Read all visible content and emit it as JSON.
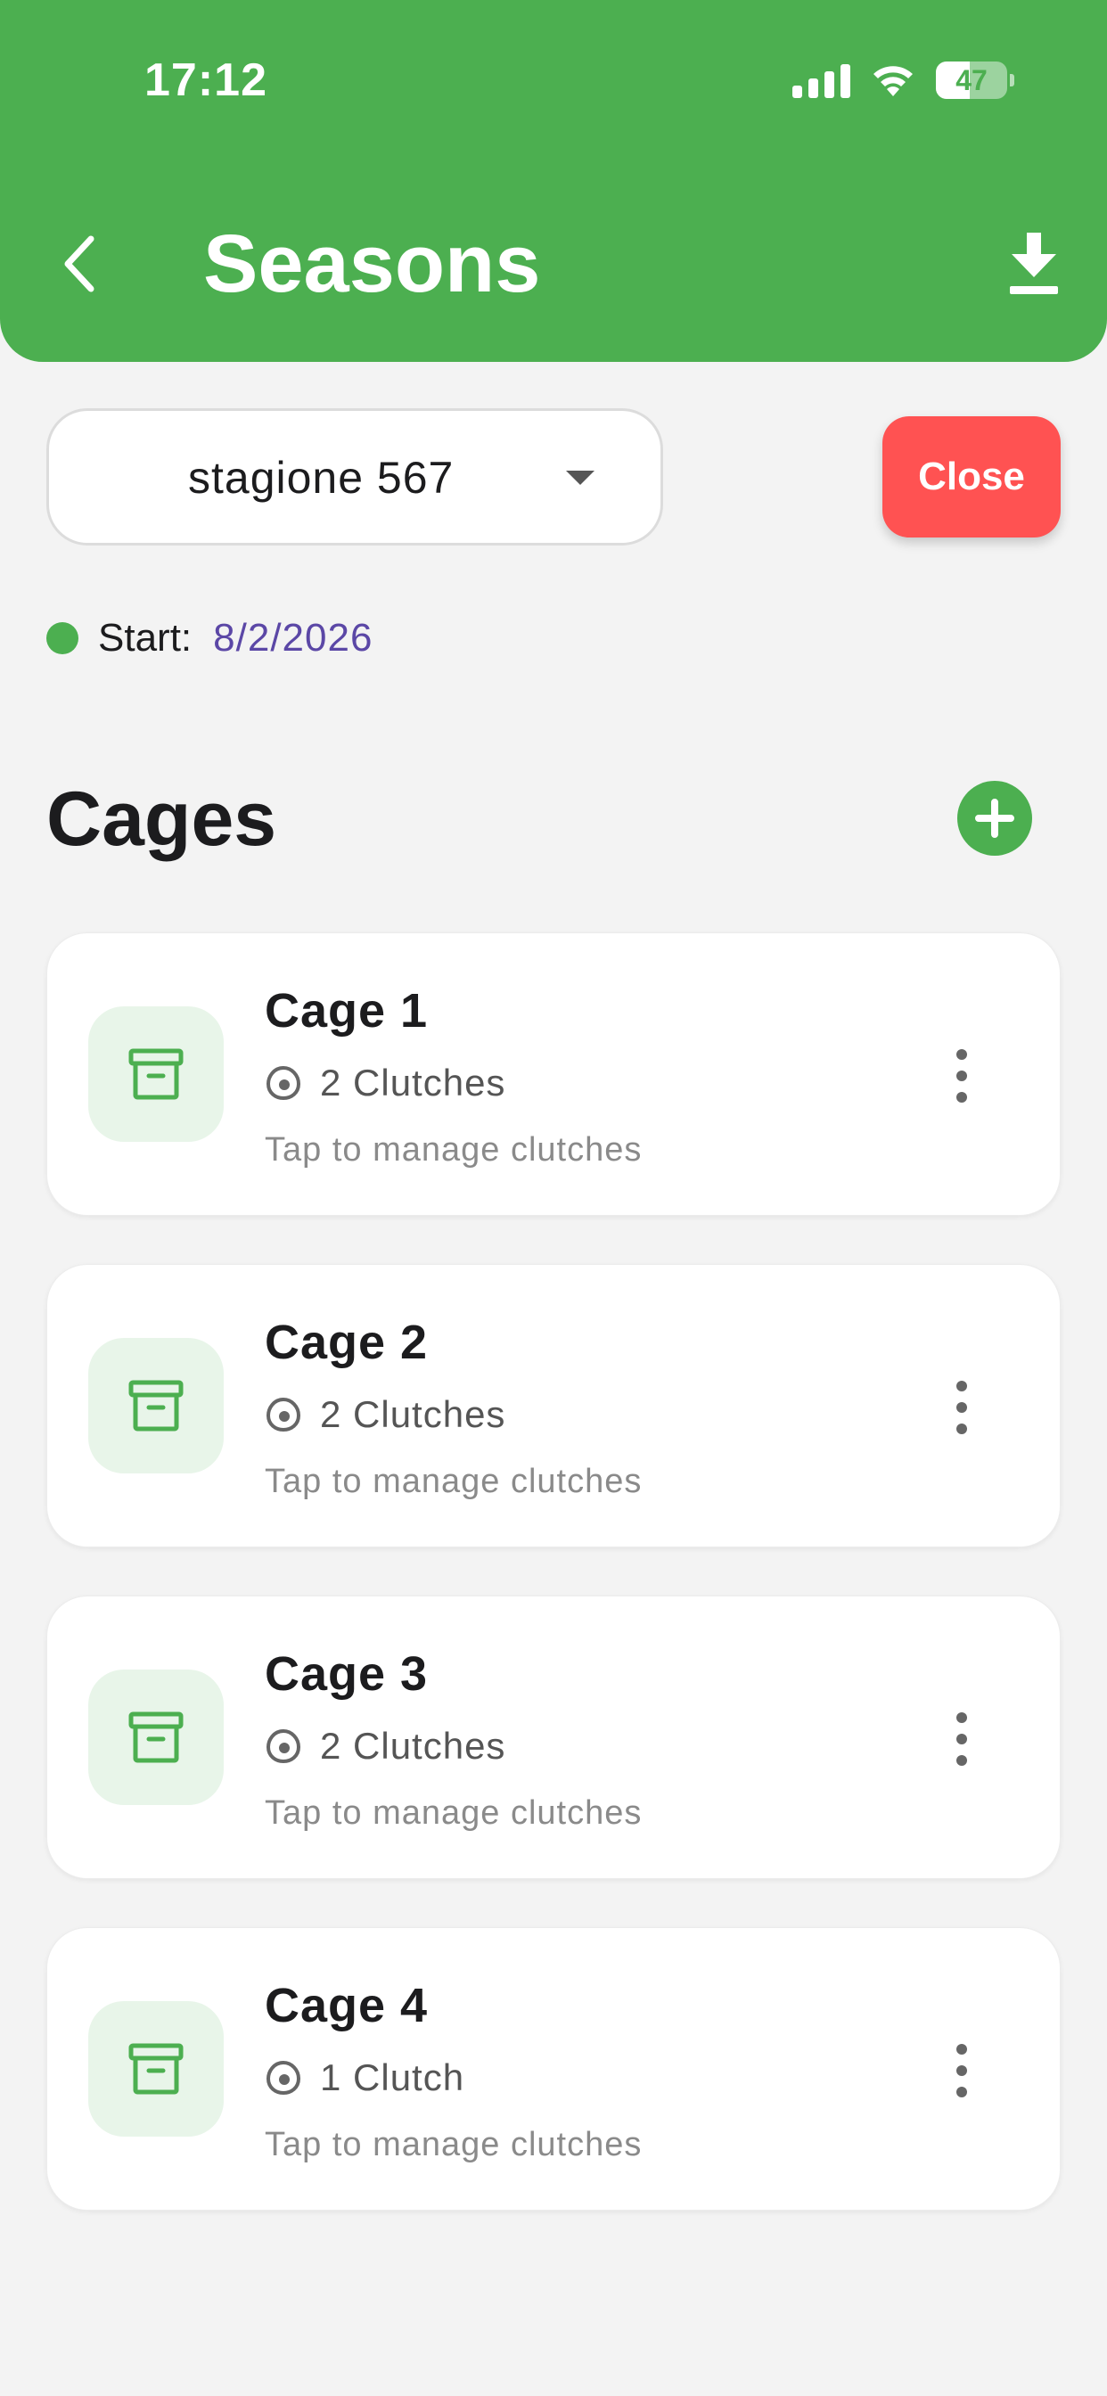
{
  "status_bar": {
    "time": "17:12",
    "battery": "47"
  },
  "header": {
    "title": "Seasons"
  },
  "season": {
    "selected": "stagione 567",
    "close_label": "Close"
  },
  "start": {
    "label": "Start:",
    "date": "8/2/2026"
  },
  "cages": {
    "title": "Cages",
    "items": [
      {
        "name": "Cage 1",
        "clutches": "2 Clutches",
        "hint": "Tap to manage clutches"
      },
      {
        "name": "Cage 2",
        "clutches": "2 Clutches",
        "hint": "Tap to manage clutches"
      },
      {
        "name": "Cage 3",
        "clutches": "2 Clutches",
        "hint": "Tap to manage clutches"
      },
      {
        "name": "Cage 4",
        "clutches": "1 Clutch",
        "hint": "Tap to manage clutches"
      }
    ]
  },
  "colors": {
    "accent": "#4caf50",
    "danger": "#ff5252",
    "date": "#5b47a6",
    "icon_bg": "#e8f5e9"
  },
  "icons": {
    "back": "chevron-left-icon",
    "download": "download-icon",
    "add": "plus-icon",
    "cage": "archive-box-icon",
    "clutch": "egg-icon",
    "more": "more-vertical-icon"
  }
}
